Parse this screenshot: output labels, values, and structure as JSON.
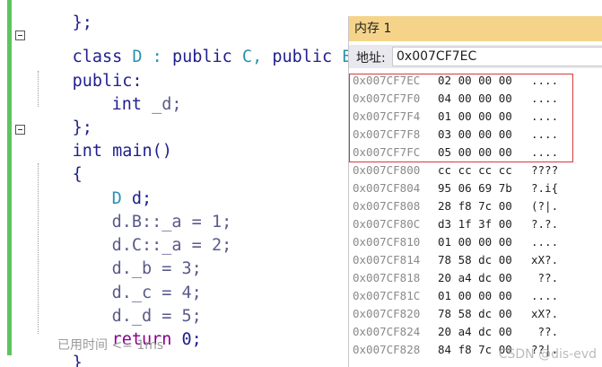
{
  "editor": {
    "top_fragment": "};",
    "lines": [
      {
        "kw1": "class",
        "name": " D : ",
        "kw2": "public",
        "base1": " C, ",
        "kw3": "public",
        "base2": " B {"
      },
      {
        "text": "public:"
      },
      {
        "type": "int",
        "member": " _d;"
      },
      {
        "text": "};"
      },
      {
        "type": "int",
        "fn": " main()"
      },
      {
        "text": "{"
      },
      {
        "type": "D",
        "text": " d;"
      },
      {
        "text": "d.B::_a = 1;"
      },
      {
        "text": "d.C::_a = 2;"
      },
      {
        "text": "d._b = 3;"
      },
      {
        "text": "d._c = 4;"
      },
      {
        "text": "d._d = 5;"
      },
      {
        "kw": "return",
        "text": " 0;"
      },
      {
        "text": "}"
      }
    ],
    "hint": "已用时间 <= 1ms"
  },
  "memory": {
    "title": "内存 1",
    "address_label": "地址:",
    "address_value": "0x007CF7EC",
    "rows": [
      {
        "addr": "0x007CF7EC",
        "bytes": "02 00 00 00",
        "ascii": "...."
      },
      {
        "addr": "0x007CF7F0",
        "bytes": "04 00 00 00",
        "ascii": "...."
      },
      {
        "addr": "0x007CF7F4",
        "bytes": "01 00 00 00",
        "ascii": "...."
      },
      {
        "addr": "0x007CF7F8",
        "bytes": "03 00 00 00",
        "ascii": "...."
      },
      {
        "addr": "0x007CF7FC",
        "bytes": "05 00 00 00",
        "ascii": "...."
      },
      {
        "addr": "0x007CF800",
        "bytes": "cc cc cc cc",
        "ascii": "????"
      },
      {
        "addr": "0x007CF804",
        "bytes": "95 06 69 7b",
        "ascii": "?.i{"
      },
      {
        "addr": "0x007CF808",
        "bytes": "28 f8 7c 00",
        "ascii": "(?|."
      },
      {
        "addr": "0x007CF80C",
        "bytes": "d3 1f 3f 00",
        "ascii": "?.?."
      },
      {
        "addr": "0x007CF810",
        "bytes": "01 00 00 00",
        "ascii": "...."
      },
      {
        "addr": "0x007CF814",
        "bytes": "78 58 dc 00",
        "ascii": "xX?."
      },
      {
        "addr": "0x007CF818",
        "bytes": "20 a4 dc 00",
        "ascii": " ??."
      },
      {
        "addr": "0x007CF81C",
        "bytes": "01 00 00 00",
        "ascii": "...."
      },
      {
        "addr": "0x007CF820",
        "bytes": "78 58 dc 00",
        "ascii": "xX?."
      },
      {
        "addr": "0x007CF824",
        "bytes": "20 a4 dc 00",
        "ascii": " ??."
      },
      {
        "addr": "0x007CF828",
        "bytes": "84 f8 7c 00",
        "ascii": "??|."
      }
    ]
  },
  "watermark": "CSDN @dis-evd"
}
